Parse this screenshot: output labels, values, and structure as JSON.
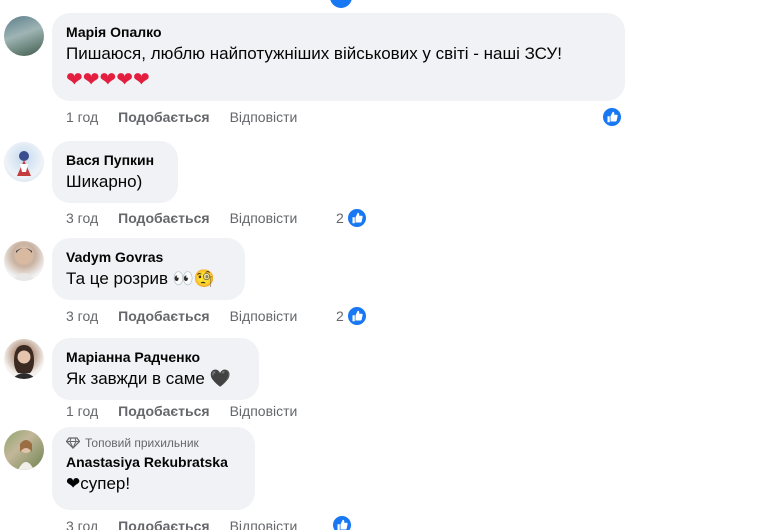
{
  "comments": [
    {
      "author": "Марія Опалко",
      "text": "Пишаюся, люблю найпотужніших військових у світі - наші ЗСУ!",
      "hearts": "❤❤❤❤❤",
      "time": "1 год",
      "like_label": "Подобається",
      "reply_label": "Відповісти",
      "reactions": ""
    },
    {
      "author": "Вася Пупкин",
      "text": "Шикарно)",
      "time": "3 год",
      "like_label": "Подобається",
      "reply_label": "Відповісти",
      "reactions": "2"
    },
    {
      "author": "Vadym Govras",
      "text": "Та це розрив 👀🧐",
      "time": "3 год",
      "like_label": "Подобається",
      "reply_label": "Відповісти",
      "reactions": "2"
    },
    {
      "author": "Маріанна Радченко",
      "text": "Як завжди в саме 🖤",
      "time": "1 год",
      "like_label": "Подобається",
      "reply_label": "Відповісти",
      "reactions": ""
    },
    {
      "author": "Anastasiya Rekubratska",
      "badge": "Топовий прихильник",
      "text": "❤супер!",
      "time": "3 год",
      "like_label": "Подобається",
      "reply_label": "Відповісти",
      "reactions": ""
    }
  ],
  "colors": {
    "bubble": "#f0f2f5",
    "accent": "#1877f2",
    "meta": "#65676b"
  }
}
